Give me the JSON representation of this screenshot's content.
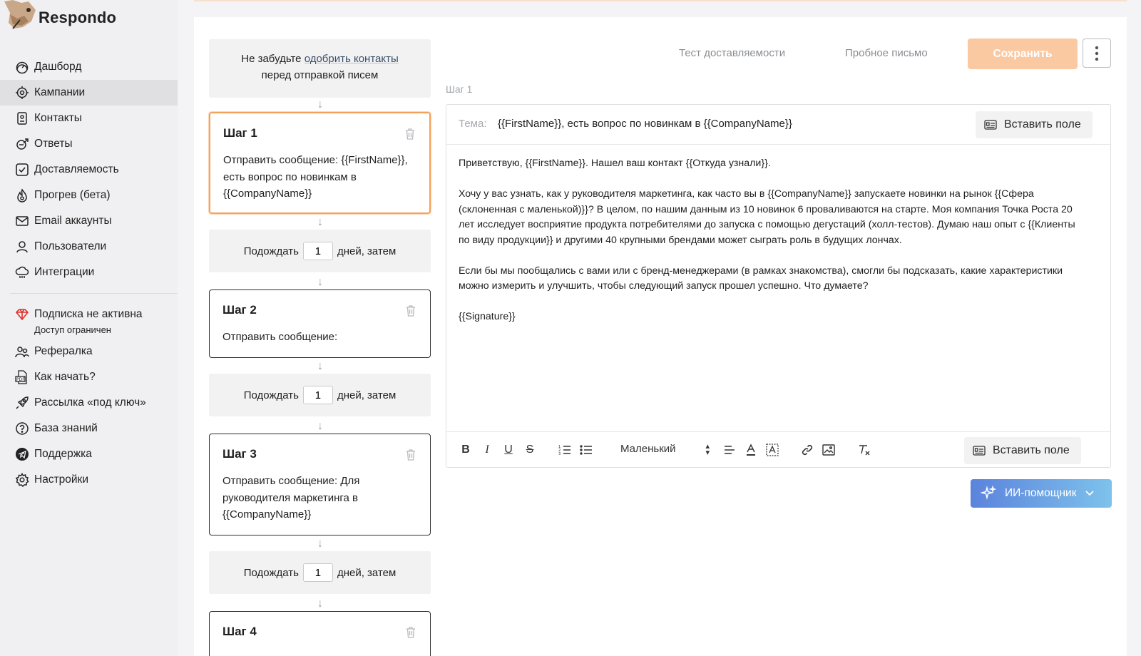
{
  "app": {
    "name": "Respondo"
  },
  "sidebar": {
    "items": [
      {
        "label": "Дашборд",
        "icon": "dashboard-icon"
      },
      {
        "label": "Кампании",
        "icon": "target-icon"
      },
      {
        "label": "Контакты",
        "icon": "contact-card-icon"
      },
      {
        "label": "Ответы",
        "icon": "reply-icon"
      },
      {
        "label": "Доставляемость",
        "icon": "check-square-icon"
      },
      {
        "label": "Прогрев (бета)",
        "icon": "flame-icon"
      },
      {
        "label": "Email аккаунты",
        "icon": "mail-icon"
      },
      {
        "label": "Пользователи",
        "icon": "user-icon"
      },
      {
        "label": "Интеграции",
        "icon": "cloud-icon"
      }
    ],
    "active_index": 1,
    "subscription": {
      "label": "Подписка не активна",
      "note": "Доступ ограничен",
      "icon": "diamond-icon"
    },
    "secondary": [
      {
        "label": "Рефералка",
        "icon": "users-icon"
      },
      {
        "label": "Как начать?",
        "icon": "pdf-icon"
      },
      {
        "label": "Рассылка «под ключ»",
        "icon": "rocket-icon"
      },
      {
        "label": "База знаний",
        "icon": "help-icon"
      },
      {
        "label": "Поддержка",
        "icon": "telegram-icon"
      },
      {
        "label": "Настройки",
        "icon": "gear-icon"
      }
    ]
  },
  "reminder": {
    "prefix": "Не забудьте ",
    "link": "одобрить контакты",
    "suffix": "перед отправкой писем"
  },
  "steps": [
    {
      "title": "Шаг 1",
      "text": "Отправить сообщение: {{FirstName}}, есть вопрос по новинкам в {{CompanyName}}"
    },
    {
      "title": "Шаг 2",
      "text": "Отправить сообщение:"
    },
    {
      "title": "Шаг 3",
      "text": "Отправить сообщение: Для руководителя маркетинга в {{CompanyName}}"
    },
    {
      "title": "Шаг 4",
      "text": ""
    }
  ],
  "waits": [
    {
      "prefix": "Подождать",
      "days": "1",
      "suffix": "дней, затем"
    },
    {
      "prefix": "Подождать",
      "days": "1",
      "suffix": "дней, затем"
    },
    {
      "prefix": "Подождать",
      "days": "1",
      "suffix": "дней, затем"
    }
  ],
  "actions": {
    "deliverability_test": "Тест доставляемости",
    "test_email": "Пробное письмо",
    "save": "Сохранить"
  },
  "editor": {
    "step_label": "Шаг 1",
    "subject_label": "Тема:",
    "subject": "{{FirstName}}, есть вопрос по новинкам в {{CompanyName}}",
    "insert_field": "Вставить поле",
    "body": [
      "Приветствую, {{FirstName}}. Нашел ваш контакт {{Откуда узнали}}.",
      "Хочу у вас узнать, как у руководителя маркетинга, как часто вы в {{CompanyName}} запускаете новинки на рынок {{Сфера (склоненная с маленькой)}}? В целом, по нашим данным из 10 новинок 6 проваливаются на старте. Моя компания Точка Роста 20 лет исследует восприятие продукта потребителями до запуска с помощью дегустаций (холл-тестов). Думаю наш опыт с {{Клиенты по виду продукции}} и другими 40 крупными брендами может сыграть роль в будущих лончах.",
      "Если бы мы пообщались с вами или с бренд-менеджерами (в рамках знакомства), смогли бы подсказать, какие характеристики можно измерить и улучшить, чтобы следующий запуск прошел успешно. Что думаете?",
      "{{Signature}}"
    ],
    "font_size": "Маленький",
    "insert_field_bottom": "Вставить поле"
  },
  "ai_helper": {
    "label": "ИИ-помощник"
  },
  "colors": {
    "accent_orange": "#f5a15a",
    "save_disabled": "#fbc9a1",
    "ai_gradient_start": "#5b83dc",
    "ai_gradient_end": "#7ec2ec"
  }
}
